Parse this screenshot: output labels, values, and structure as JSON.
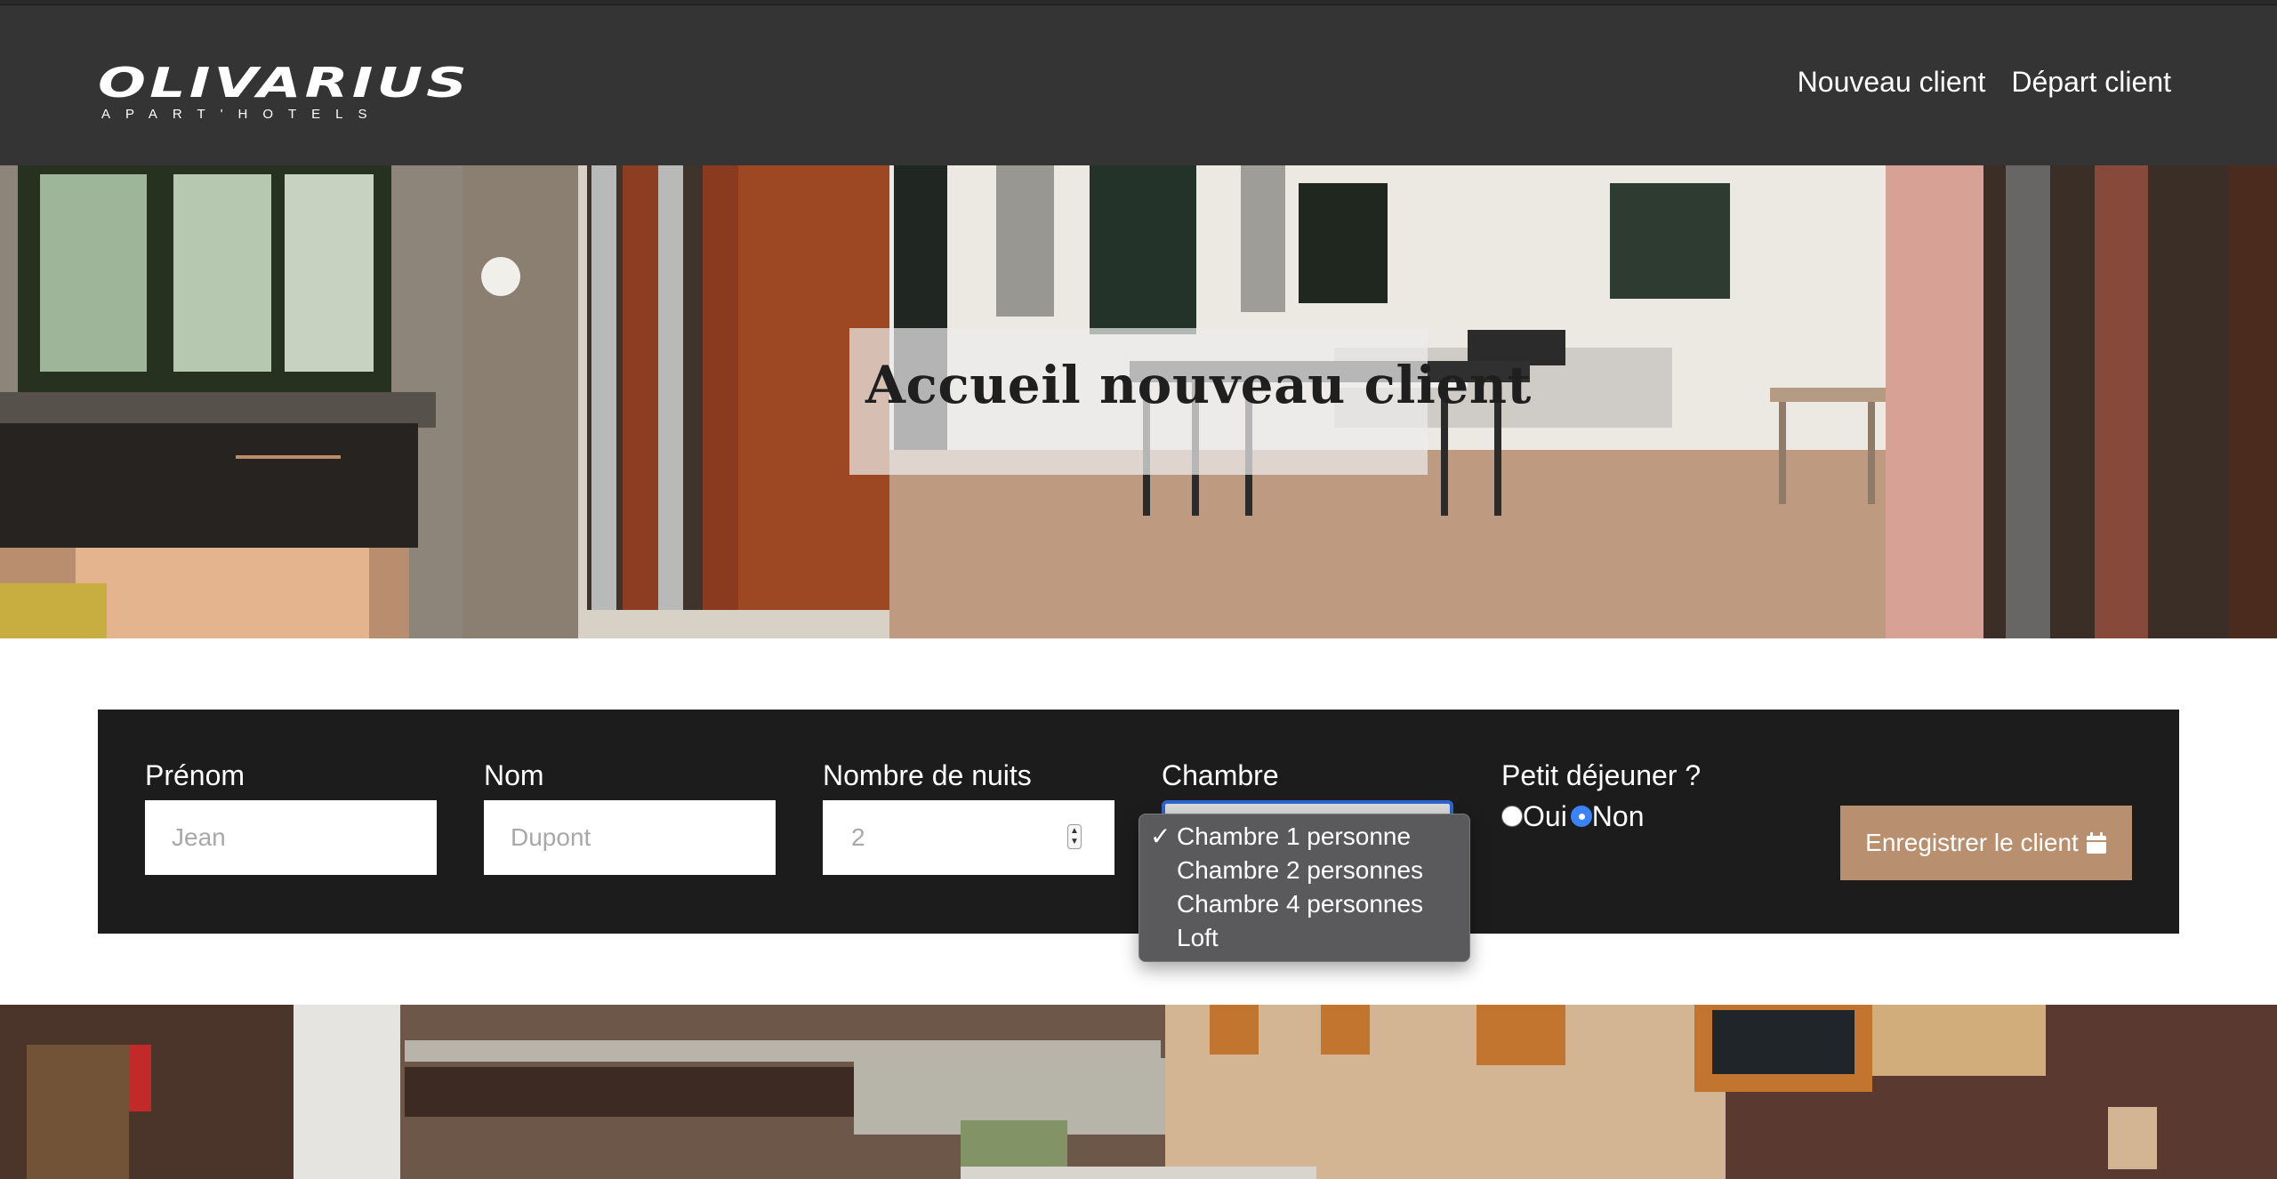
{
  "logo": {
    "main": "OLIVARIUS",
    "sub": "APART'HOTELS"
  },
  "nav": {
    "items": [
      {
        "label": "Nouveau client"
      },
      {
        "label": "Départ client"
      }
    ]
  },
  "hero": {
    "title": "Accueil nouveau client"
  },
  "form": {
    "first_name": {
      "label": "Prénom",
      "placeholder": "Jean"
    },
    "last_name": {
      "label": "Nom",
      "placeholder": "Dupont"
    },
    "nights": {
      "label": "Nombre de nuits",
      "value": "2"
    },
    "room": {
      "label": "Chambre",
      "options": [
        "Chambre 1 personne",
        "Chambre 2 personnes",
        "Chambre 4 personnes",
        "Loft"
      ],
      "selected": "Chambre 1 personne"
    },
    "breakfast": {
      "label": "Petit déjeuner ?",
      "yes_label": "Oui",
      "no_label": "Non",
      "selected": "Non"
    },
    "submit_label": "Enregistrer le client",
    "submit_icon": "calendar-icon"
  },
  "colors": {
    "navbar": "#343434",
    "panel": "#1c1c1c",
    "accent": "#b8906f",
    "radio_selected": "#3b82f6"
  }
}
